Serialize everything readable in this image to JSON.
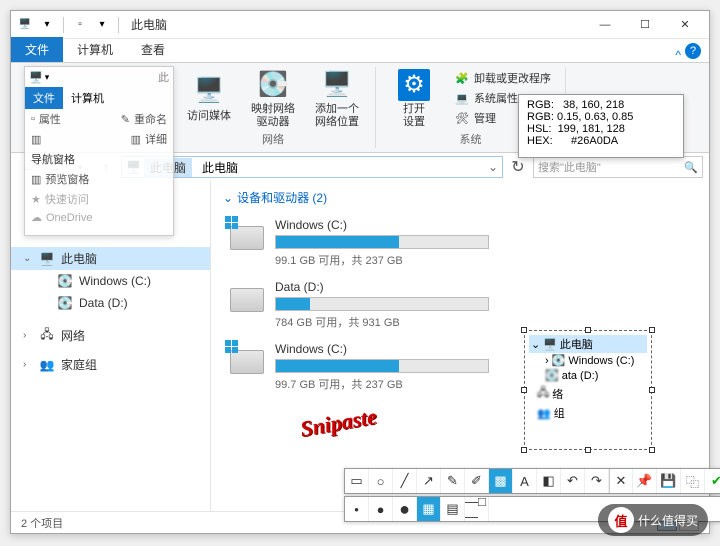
{
  "window": {
    "title": "此电脑",
    "tabs": {
      "file": "文件",
      "computer": "计算机",
      "view": "查看"
    }
  },
  "ribbon": {
    "group_net": "网络",
    "group_sys": "系统",
    "media": "访问媒体",
    "mapdrive": "映射网络\n驱动器",
    "addloc": "添加一个\n网络位置",
    "opensettings": "打开\n设置",
    "uninstall": "卸载或更改程序",
    "sysprops": "系统属性",
    "manage": "管理"
  },
  "addr": {
    "segment": "此电脑",
    "text": "此电脑"
  },
  "search_placeholder": "搜索\"此电脑\"",
  "nav": {
    "thispc": "此电脑",
    "c": "Windows (C:)",
    "d": "Data (D:)",
    "network": "网络",
    "homegroup": "家庭组"
  },
  "content": {
    "group_header": "设备和驱动器 (2)",
    "drives": [
      {
        "name": "Windows (C:)",
        "stat": "99.1 GB 可用，共 237 GB",
        "fill": 58,
        "win": true
      },
      {
        "name": "Data (D:)",
        "stat": "784 GB 可用，共 931 GB",
        "fill": 16,
        "win": false
      },
      {
        "name": "Windows (C:)",
        "stat": "99.7 GB 可用，共 237 GB",
        "fill": 58,
        "win": true
      }
    ]
  },
  "status": "2 个项目",
  "ghost": {
    "file": "文件",
    "computer": "计算机",
    "thispc": "此",
    "props": "属性",
    "rename": "重命名",
    "details": "详细",
    "navpane": "导航窗格",
    "preview": "预览窗格",
    "quick": "快速访问",
    "onedrive": "OneDrive"
  },
  "colorbox": {
    "rgb": "RGB:   38, 160, 218",
    "rgbf": "RGB: 0.15, 0.63, 0.85",
    "hsl": "HSL:  199, 181, 128",
    "hex": "HEX:      #26A0DA"
  },
  "sniptree": {
    "root": "此电脑",
    "c": "Windows (C:)",
    "d": "ata (D:)",
    "net": "络",
    "hg": "组"
  },
  "snipaste": "Snipaste",
  "watermark": "什么值得买"
}
